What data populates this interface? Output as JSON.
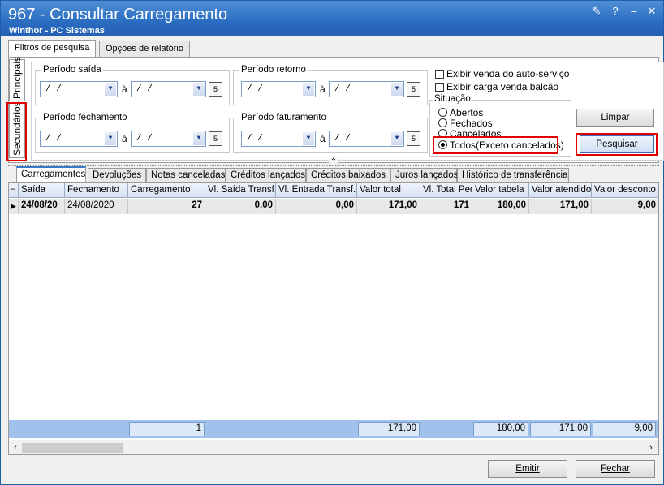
{
  "window": {
    "title": "967 - Consultar Carregamento",
    "subtitle": "Winthor - PC Sistemas"
  },
  "main_tabs": [
    "Filtros de pesquisa",
    "Opções de relatório"
  ],
  "side_tabs": {
    "principais": "Principais",
    "secundarios": "Secundários"
  },
  "filters": {
    "periodo_saida": "Período saída",
    "periodo_retorno": "Período retorno",
    "periodo_fechamento": "Período fechamento",
    "periodo_faturamento": "Período faturamento",
    "date_value": "/ /",
    "a_label": "à"
  },
  "checks": {
    "auto_servico": "Exibir venda do auto-serviço",
    "balcao": "Exibir carga venda balcão"
  },
  "situacao": {
    "label": "Situação",
    "options": [
      "Abertos",
      "Fechados",
      "Cancelados",
      "Todos(Exceto cancelados)"
    ],
    "selected": "Todos(Exceto cancelados)"
  },
  "buttons": {
    "limpar": "Limpar",
    "pesquisar": "Pesquisar",
    "emitir": "Emitir",
    "fechar": "Fechar"
  },
  "result_tabs": [
    "Carregamentos",
    "Devoluções",
    "Notas canceladas",
    "Créditos lançados",
    "Créditos baixados",
    "Juros lançados",
    "Histórico de transferência"
  ],
  "grid": {
    "columns": [
      "Saída",
      "Fechamento",
      "Carregamento",
      "Vl. Saída Transf.",
      "Vl. Entrada Transf.",
      "Valor total",
      "Vl. Total Ped",
      "Valor tabela",
      "Valor atendido",
      "Valor desconto"
    ],
    "rows": [
      [
        "24/08/20",
        "24/08/2020",
        "27",
        "0,00",
        "0,00",
        "171,00",
        "171",
        "180,00",
        "171,00",
        "9,00"
      ]
    ],
    "totals": {
      "carregamento": "1",
      "valor_total": "171,00",
      "valor_tabela": "180,00",
      "valor_atendido": "171,00",
      "valor_desconto": "9,00"
    }
  }
}
